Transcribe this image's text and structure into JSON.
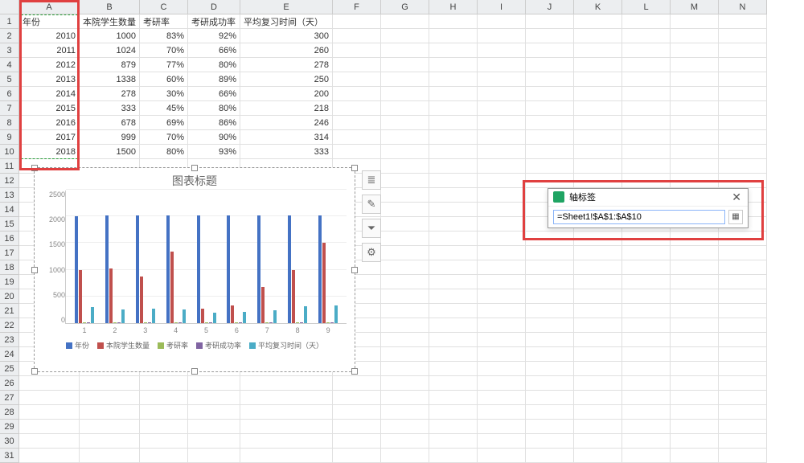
{
  "columns": [
    "",
    "A",
    "B",
    "C",
    "D",
    "E",
    "F",
    "G",
    "H",
    "I",
    "J",
    "K",
    "L",
    "M",
    "N"
  ],
  "rows": 31,
  "headers": [
    "年份",
    "本院学生数量",
    "考研率",
    "考研成功率",
    "平均复习时间（天）"
  ],
  "data": [
    [
      "2010",
      "1000",
      "83%",
      "92%",
      "300"
    ],
    [
      "2011",
      "1024",
      "70%",
      "66%",
      "260"
    ],
    [
      "2012",
      "879",
      "77%",
      "80%",
      "278"
    ],
    [
      "2013",
      "1338",
      "60%",
      "89%",
      "250"
    ],
    [
      "2014",
      "278",
      "30%",
      "66%",
      "200"
    ],
    [
      "2015",
      "333",
      "45%",
      "80%",
      "218"
    ],
    [
      "2016",
      "678",
      "69%",
      "86%",
      "246"
    ],
    [
      "2017",
      "999",
      "70%",
      "90%",
      "314"
    ],
    [
      "2018",
      "1500",
      "80%",
      "93%",
      "333"
    ]
  ],
  "chart": {
    "title": "图表标题",
    "y_ticks": [
      "2500",
      "2000",
      "1500",
      "1000",
      "500",
      "0"
    ],
    "legend": [
      "年份",
      "本院学生数量",
      "考研率",
      "考研成功率",
      "平均复习时间（天）"
    ],
    "colors": [
      "#4472c4",
      "#c0504d",
      "#9bbb59",
      "#8064a2",
      "#4bacc6"
    ],
    "categories": [
      "1",
      "2",
      "3",
      "4",
      "5",
      "6",
      "7",
      "8",
      "9"
    ],
    "y_max": 2500
  },
  "chart_data": {
    "type": "bar",
    "categories": [
      "1",
      "2",
      "3",
      "4",
      "5",
      "6",
      "7",
      "8",
      "9"
    ],
    "series": [
      {
        "name": "年份",
        "values": [
          2010,
          2011,
          2012,
          2013,
          2014,
          2015,
          2016,
          2017,
          2018
        ]
      },
      {
        "name": "本院学生数量",
        "values": [
          1000,
          1024,
          879,
          1338,
          278,
          333,
          678,
          999,
          1500
        ]
      },
      {
        "name": "考研率",
        "values": [
          0.83,
          0.7,
          0.77,
          0.6,
          0.3,
          0.45,
          0.69,
          0.7,
          0.8
        ]
      },
      {
        "name": "考研成功率",
        "values": [
          0.92,
          0.66,
          0.8,
          0.89,
          0.66,
          0.8,
          0.86,
          0.9,
          0.93
        ]
      },
      {
        "name": "平均复习时间（天）",
        "values": [
          300,
          260,
          278,
          250,
          200,
          218,
          246,
          314,
          333
        ]
      }
    ],
    "title": "图表标题",
    "ylim": [
      0,
      2500
    ]
  },
  "dialog": {
    "title": "轴标签",
    "value": "=Sheet1!$A$1:$A$10"
  },
  "side_icons": [
    "chart-element-icon",
    "brush-icon",
    "filter-icon",
    "gear-icon"
  ],
  "side_glyphs": [
    "≣",
    "✎",
    "⏷",
    "⚙"
  ]
}
